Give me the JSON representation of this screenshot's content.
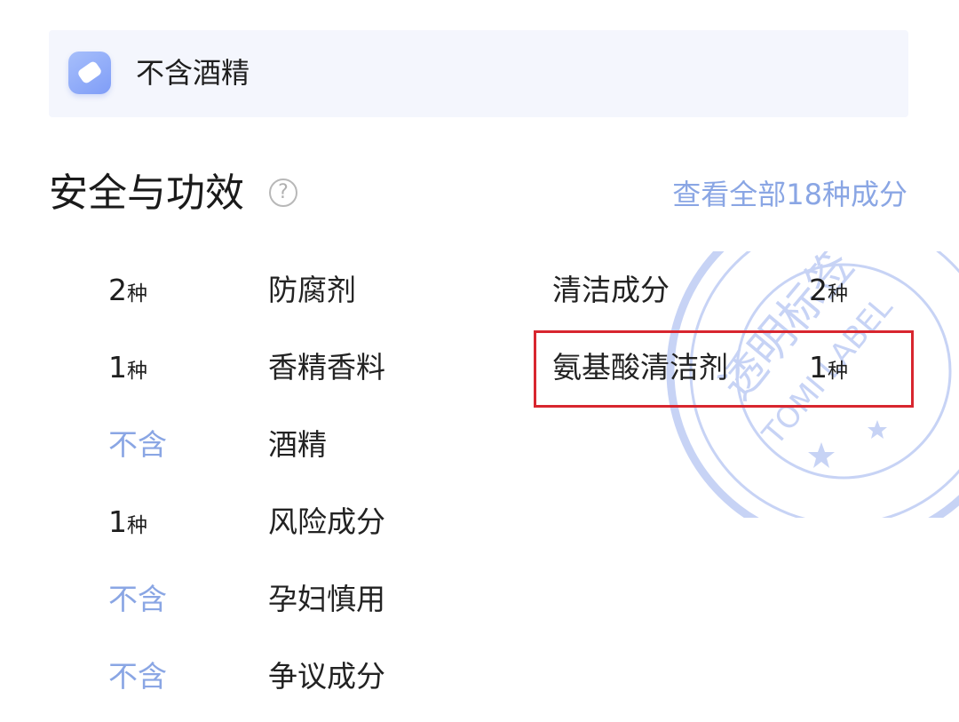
{
  "banner": {
    "icon": "pill-icon",
    "text": "不含酒精"
  },
  "section": {
    "title": "安全与功效",
    "help_icon_glyph": "?",
    "view_all_link": "查看全部18种成分"
  },
  "left_rows": [
    {
      "count": "2",
      "unit": "种",
      "label": "防腐剂"
    },
    {
      "count": "1",
      "unit": "种",
      "label": "香精香料"
    },
    {
      "count": "不含",
      "unit": "",
      "label": "酒精"
    },
    {
      "count": "1",
      "unit": "种",
      "label": "风险成分"
    },
    {
      "count": "不含",
      "unit": "",
      "label": "孕妇慎用"
    },
    {
      "count": "不含",
      "unit": "",
      "label": "争议成分"
    }
  ],
  "right_rows": [
    {
      "label": "清洁成分",
      "count": "2",
      "unit": "种",
      "highlighted": false
    },
    {
      "label": "氨基酸清洁剂",
      "count": "1",
      "unit": "种",
      "highlighted": true
    }
  ],
  "watermark": {
    "cn_text": "透明标签",
    "en_text": "TOMI LABEL"
  },
  "colors": {
    "accent_blue": "#8aa6e4",
    "highlight_red": "#d8262f",
    "banner_bg": "#f4f6fd",
    "stamp": "#c7d3f5"
  }
}
